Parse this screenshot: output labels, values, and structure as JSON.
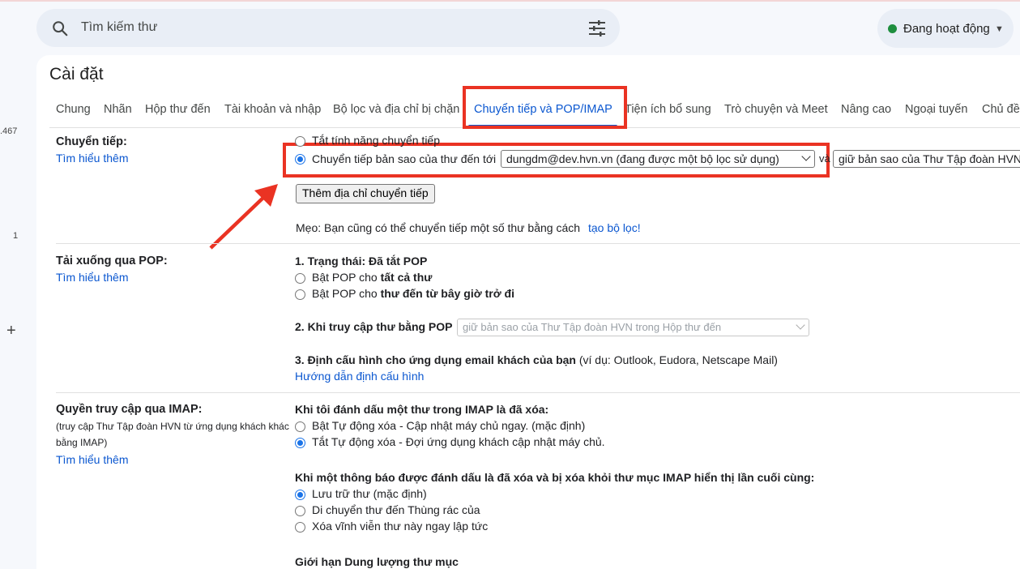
{
  "rail": {
    "num_top": ".467",
    "num_mid": "1",
    "plus": "+"
  },
  "search": {
    "placeholder": "Tìm kiếm thư"
  },
  "status": {
    "label": "Đang hoạt động",
    "color": "#1e8e3e"
  },
  "page_title": "Cài đặt",
  "tabs": [
    "Chung",
    "Nhãn",
    "Hộp thư đến",
    "Tài khoản và nhập",
    "Bộ lọc và địa chỉ bị chặn",
    "Chuyển tiếp và POP/IMAP",
    "Tiện ích bổ sung",
    "Trò chuyện và Meet",
    "Nâng cao",
    "Ngoại tuyến",
    "Chủ đề"
  ],
  "active_tab": "Chuyển tiếp và POP/IMAP",
  "forwarding": {
    "label": "Chuyển tiếp:",
    "learn_more": "Tìm hiểu thêm",
    "option_off": "Tắt tính năng chuyển tiếp",
    "option_on": "Chuyển tiếp bản sao của thư đến tới",
    "address_select": "dungdm@dev.hvn.vn (đang được một bộ lọc sử dụng)",
    "and": "và",
    "keep_select": "giữ bản sao của Thư Tập đoàn HVN",
    "add_button": "Thêm địa chỉ chuyển tiếp",
    "tip_prefix": "Mẹo: Bạn cũng có thể chuyển tiếp một số thư bằng cách",
    "tip_link": "tạo bộ lọc!"
  },
  "pop": {
    "label": "Tải xuống qua POP:",
    "learn_more": "Tìm hiểu thêm",
    "status": "1. Trạng thái: Đã tắt POP",
    "opt1_prefix": "Bật POP cho",
    "opt1_bold": "tất cả thư",
    "opt2_prefix": "Bật POP cho",
    "opt2_bold": "thư đến từ bây giờ trở đi",
    "access_label": "2. Khi truy cập thư bằng POP",
    "access_select": "giữ bản sao của Thư Tập đoàn HVN trong Hộp thư đến",
    "config_label": "3. Định cấu hình cho ứng dụng email khách của bạn",
    "config_hint": "(ví dụ: Outlook, Eudora, Netscape Mail)",
    "config_link": "Hướng dẫn định cấu hình"
  },
  "imap": {
    "label": "Quyền truy cập qua IMAP:",
    "sub1": "(truy cập Thư Tập đoàn HVN từ ứng dụng khách khác",
    "sub2": "bằng IMAP)",
    "learn_more": "Tìm hiểu thêm",
    "q1": "Khi tôi đánh dấu một thư trong IMAP là đã xóa:",
    "q1_opt1": "Bật Tự động xóa - Cập nhật máy chủ ngay. (mặc định)",
    "q1_opt2": "Tắt Tự động xóa - Đợi ứng dụng khách cập nhật máy chủ.",
    "q2": "Khi một thông báo được đánh dấu là đã xóa và bị xóa khỏi thư mục IMAP hiển thị lần cuối cùng:",
    "q2_opt1": "Lưu trữ thư (mặc định)",
    "q2_opt2": "Di chuyển thư đến Thùng rác của",
    "q2_opt3": "Xóa vĩnh viễn thư này ngay lập tức",
    "q3": "Giới hạn Dung lượng thư mục"
  },
  "highlight_color": "#ea3323"
}
